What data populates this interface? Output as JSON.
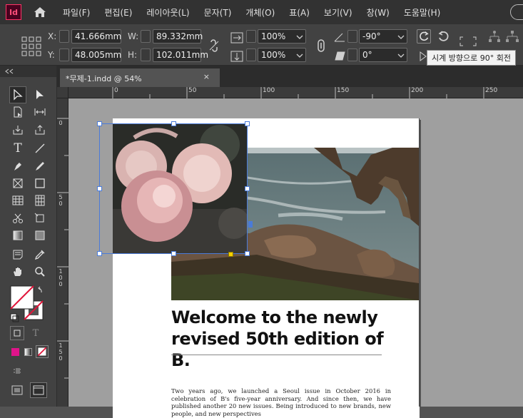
{
  "app": {
    "logo": "Id"
  },
  "menu": [
    "파일(F)",
    "편집(E)",
    "레이아웃(L)",
    "문자(T)",
    "개체(O)",
    "표(A)",
    "보기(V)",
    "창(W)",
    "도움말(H)"
  ],
  "control": {
    "x_label": "X:",
    "x_value": "41.666mm",
    "y_label": "Y:",
    "y_value": "48.005mm",
    "w_label": "W:",
    "w_value": "89.332mm",
    "h_label": "H:",
    "h_value": "102.011mm",
    "scale_x": "100%",
    "scale_y": "100%",
    "rotate": "-90°",
    "shear": "0°"
  },
  "tooltip": "시계 방향으로 90° 회전",
  "tab": {
    "title": "*무제-1.indd @ 54%",
    "close": "×"
  },
  "ruler": {
    "top": [
      "0",
      "50",
      "100",
      "150",
      "200",
      "250"
    ],
    "left": [
      "0",
      "50",
      "100",
      "150"
    ]
  },
  "document": {
    "headline": "Welcome to the newly revised 50th edition of B.",
    "body": "Two years ago, we launched a Seoul issue in October 2016 in celebration of B's five-year anniversary. And since then, we have published another 20 new issues. Being introduced to new brands, new people, and new perspectives"
  },
  "tools_panel": {
    "preview_label": "T"
  },
  "colors": {
    "accent": "#ff3366",
    "selection": "#4a7bd9",
    "pasteboard": "#9f9f9f"
  }
}
